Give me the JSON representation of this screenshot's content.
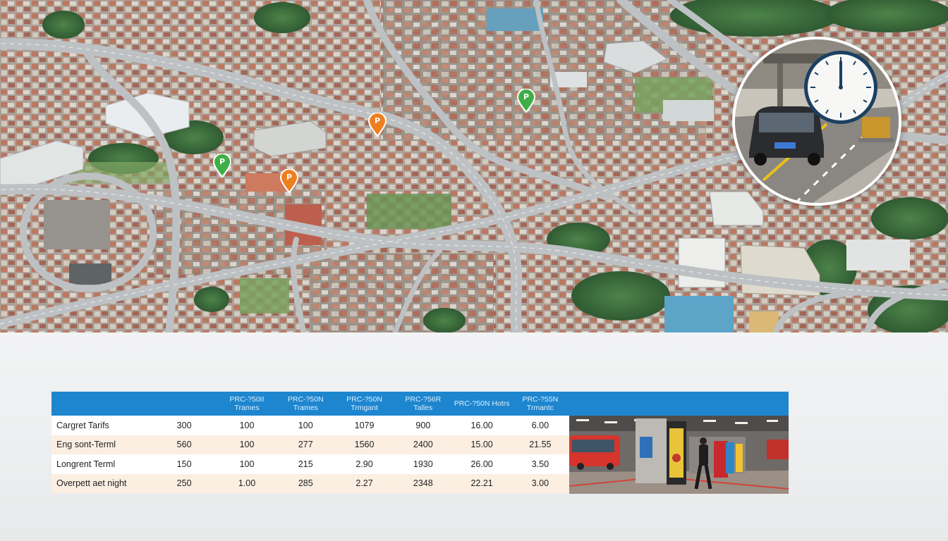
{
  "tariff_table": {
    "headers": [
      "",
      "",
      "PRC-?50II Trames",
      "PRC-?50N Trames",
      "PRC-?50N Trmgant",
      "PRC-?56R Talles",
      "PRC-?50N Hotrs",
      "PRC-?55N Trmantc"
    ],
    "rows": [
      {
        "label": "Cargret Tarifs",
        "values": [
          "300",
          "100",
          "100",
          "1079",
          "900",
          "16.00",
          "6.00"
        ]
      },
      {
        "label": "Eng sont-Terml",
        "values": [
          "560",
          "100",
          "277",
          "1560",
          "2400",
          "15.00",
          "21.55"
        ]
      },
      {
        "label": "Longrent Terml",
        "values": [
          "150",
          "100",
          "215",
          "2.90",
          "1930",
          "26.00",
          "3.50"
        ]
      },
      {
        "label": "Overpett aet night",
        "values": [
          "250",
          "1.00",
          "285",
          "2.27",
          "2348",
          "22.21",
          "3.00"
        ]
      }
    ]
  },
  "map": {
    "pins": [
      {
        "name": "map-pin-green-west",
        "color": "#3fae47",
        "glyph": "P"
      },
      {
        "name": "map-pin-orange-center",
        "color": "#ee7f1f",
        "glyph": "P"
      },
      {
        "name": "map-pin-orange-north",
        "color": "#ee7f1f",
        "glyph": "P"
      },
      {
        "name": "map-pin-green-north",
        "color": "#3fae47",
        "glyph": "P"
      }
    ]
  },
  "colors": {
    "header_blue": "#1e86cf",
    "row_tint": "#fbefe2",
    "pin_green": "#3fae47",
    "pin_orange": "#ee7f1f"
  }
}
